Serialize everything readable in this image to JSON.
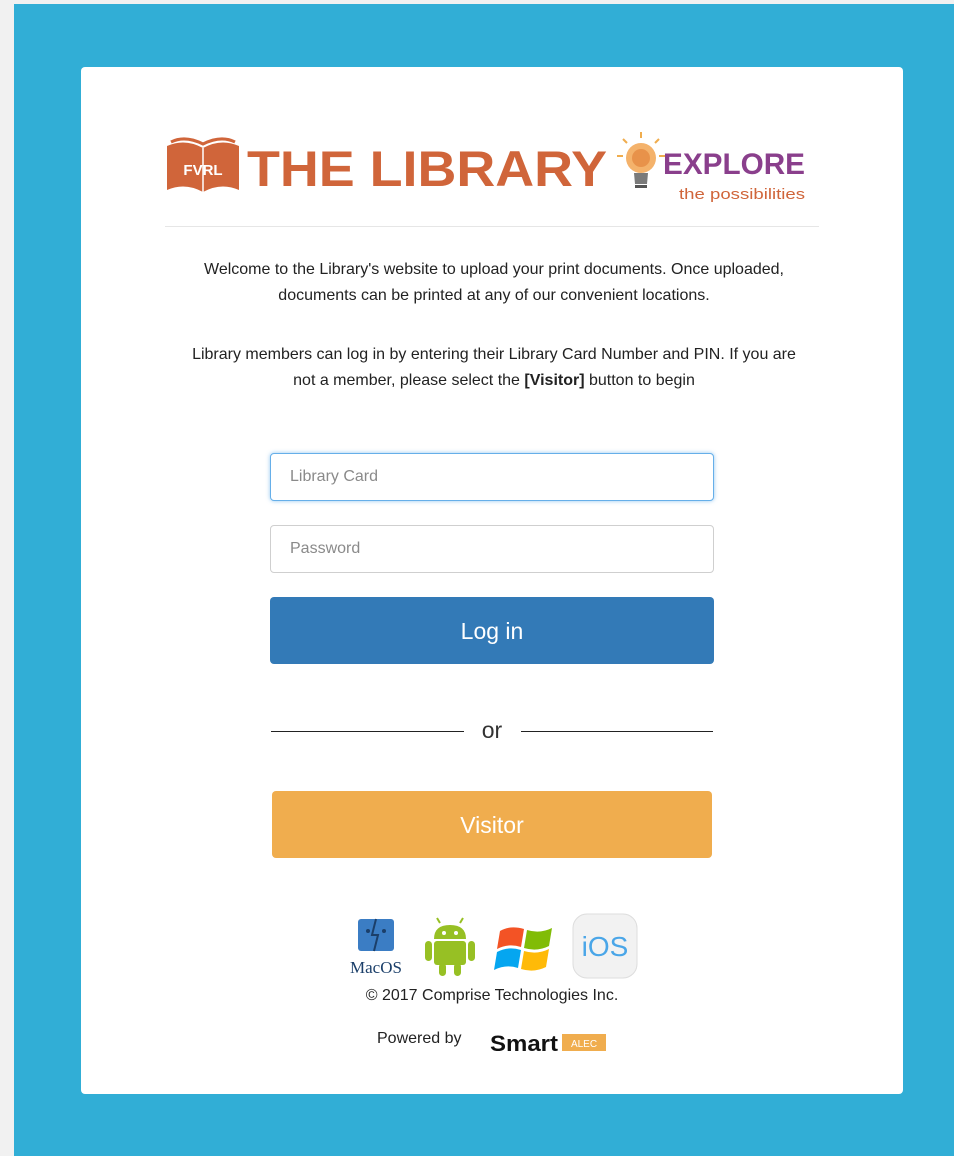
{
  "logo": {
    "badge_text": "FVRL",
    "name": "THE LIBRARY",
    "explore": "EXPLORE",
    "tagline": "the possibilities",
    "brand_color": "#d0653a",
    "accent_color": "#8a3f8c"
  },
  "intro": {
    "line1": "Welcome to the Library's website to upload your print documents. Once uploaded,",
    "line2": "documents can be printed at any of our convenient locations.",
    "line3": "Library members can log in by entering their Library Card Number and PIN. If you are",
    "line4_pre": "not a member, please select the ",
    "line4_bold": "[Visitor]",
    "line4_post": " button to begin"
  },
  "form": {
    "card_placeholder": "Library Card",
    "card_value": "",
    "password_placeholder": "Password",
    "password_value": "",
    "login_label": "Log in",
    "or_label": "or",
    "visitor_label": "Visitor"
  },
  "platforms": {
    "macos_label": "MacOS",
    "ios_label": "iOS",
    "icons": [
      "macos-icon",
      "android-icon",
      "windows-icon",
      "ios-icon"
    ]
  },
  "footer": {
    "copyright": "© 2017 Comprise Technologies Inc.",
    "powered_by": "Powered by",
    "brand_smart": "Smart",
    "brand_alec": "ALEC"
  },
  "colors": {
    "background": "#31aed6",
    "primary": "#337ab7",
    "warning": "#f0ad4e"
  }
}
